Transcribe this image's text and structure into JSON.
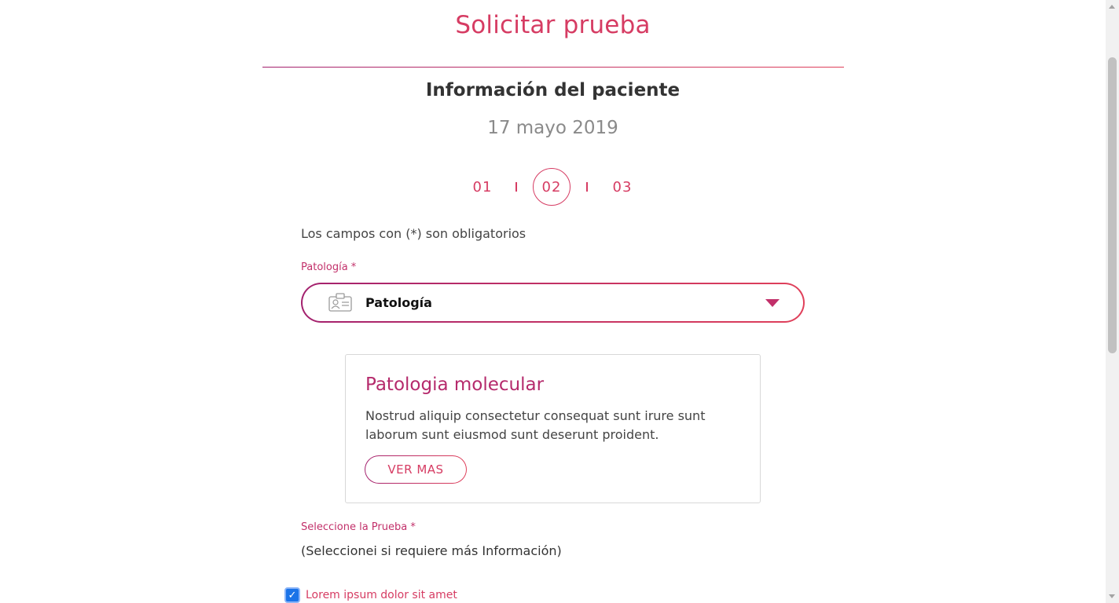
{
  "header": {
    "title": "Solicitar prueba",
    "subtitle": "Información del paciente",
    "date": "17 mayo 2019"
  },
  "steps": [
    {
      "label": "01",
      "active": false
    },
    {
      "label": "02",
      "active": true
    },
    {
      "label": "03",
      "active": false
    }
  ],
  "form": {
    "required_note": "Los campos con (*) son obligatorios",
    "pathology_label": "Patología *",
    "pathology_select": {
      "value": "Patología",
      "icon": "id-card-icon"
    },
    "test_label": "Seleccione la Prueba *",
    "test_info": "(Seleccionei si requiere más Información)",
    "checkbox": {
      "label": "Lorem ipsum dolor sit amet",
      "checked": true
    }
  },
  "card": {
    "title": "Patologia molecular",
    "text": "Nostrud aliquip consectetur consequat sunt irure sunt laborum sunt eiusmod sunt deserunt proident.",
    "button_label": "VER MAS"
  },
  "colors": {
    "accent": "#d63c63",
    "accent_dark": "#a3216e",
    "label": "#c2306a"
  }
}
